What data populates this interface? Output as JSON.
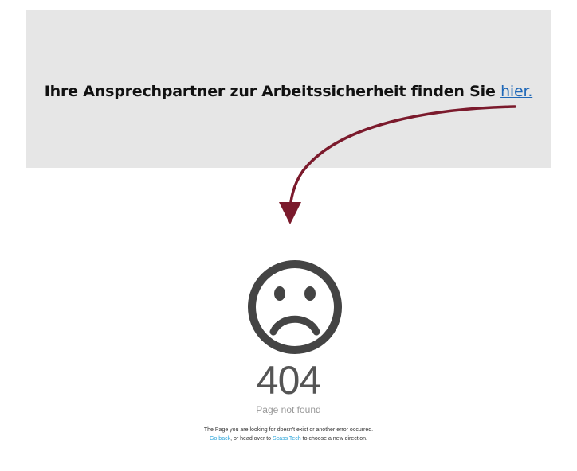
{
  "banner": {
    "text": "Ihre Ansprechpartner zur Arbeitssicherheit finden Sie",
    "link_label": "hier."
  },
  "error": {
    "icon": "sad-face-icon",
    "code": "404",
    "subtitle": "Page not found",
    "message_line1": "The Page you are looking for doesn't exist or another error occurred.",
    "go_back_label": "Go back",
    "middle_text": ", or head over to",
    "site_link_label": "Scass Tech",
    "end_text": "to choose a new direction."
  },
  "colors": {
    "banner_bg": "#e6e6e6",
    "arrow": "#7b1a2c",
    "link": "#1f68b8",
    "error_link": "#2aa4d9",
    "icon": "#444444"
  }
}
